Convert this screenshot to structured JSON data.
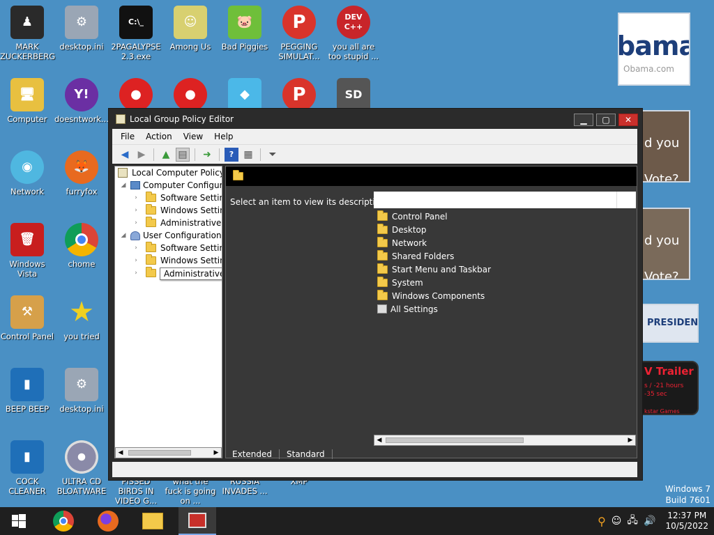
{
  "desktop": {
    "icons": [
      {
        "label": "MARK ZUCKERBERG",
        "color": "#2a2a2a"
      },
      {
        "label": "desktop.ini",
        "color": "#9aa6b5"
      },
      {
        "label": "2PAGALYPSE 2.3.exe",
        "color": "#111111"
      },
      {
        "label": "Among Us",
        "color": "#d8d070"
      },
      {
        "label": "Bad Piggies",
        "color": "#6fbf3a"
      },
      {
        "label": "PEGGING SIMULAT...",
        "color": "#d9342b"
      },
      {
        "label": "you all are too stupid ...",
        "color": "#c8252a"
      },
      {
        "label": "Computer",
        "color": "#e8c040"
      },
      {
        "label": "doesntwork...",
        "color": "#6b2fa3"
      },
      {
        "label": "Network",
        "color": "#4fb7e0"
      },
      {
        "label": "furryfox",
        "color": "#e86a1f"
      },
      {
        "label": "Windows Vista",
        "color": "#c81e1e"
      },
      {
        "label": "chome",
        "color": "#3a8ee6"
      },
      {
        "label": "Control Panel",
        "color": "#d6a04a"
      },
      {
        "label": "you tried",
        "color": "#f0d020"
      },
      {
        "label": "BEEP BEEP",
        "color": "#1f6fb8"
      },
      {
        "label": "desktop.ini",
        "color": "#9aa6b5"
      },
      {
        "label": "COCK CLEANER",
        "color": "#1f6fb8"
      },
      {
        "label": "ULTRA CD BLOATWARE",
        "color": "#bfbfbf"
      },
      {
        "label": "PISSED BIRDS IN VIDEO G...",
        "color": "#d22"
      },
      {
        "label": "what the fuck is going on ...",
        "color": "#d22"
      },
      {
        "label": "RUSSIA INVADES ...",
        "color": "#4bb8e8"
      },
      {
        "label": "XMP",
        "color": "#d9342b"
      },
      {
        "label": "",
        "color": "#555"
      }
    ]
  },
  "ads": {
    "obama_text": "bama",
    "obama_url": "Obama.com",
    "ad2_text": "d you Vote?",
    "ad3_text": "d you Vote?",
    "ad4_text": "PRESIDENT",
    "ad5_title": "V Trailer",
    "ad5_sub": "s / -21 hours -35 sec",
    "ad5_foot": "kstar Games"
  },
  "window": {
    "title": "Local Group Policy Editor",
    "menu": [
      "File",
      "Action",
      "View",
      "Help"
    ],
    "tree": {
      "root": "Local Computer Policy",
      "computer": "Computer Configura",
      "computer_children": [
        "Software Settings",
        "Windows Setting",
        "Administrative Te"
      ],
      "user": "User Configuration",
      "user_children": [
        "Software Settings",
        "Windows Setting",
        "Administrative Templates"
      ]
    },
    "tooltip": "Administrative Templates",
    "description": "Select an item to view its description.",
    "list": [
      "Control Panel",
      "Desktop",
      "Network",
      "Shared Folders",
      "Start Menu and Taskbar",
      "System",
      "Windows Components",
      "All Settings"
    ],
    "tabs": [
      "Extended",
      "Standard"
    ]
  },
  "taskbar": {
    "time": "12:37 PM",
    "date": "10/5/2022"
  },
  "watermark": {
    "line1": "Windows 7",
    "line2": "Build 7601"
  }
}
